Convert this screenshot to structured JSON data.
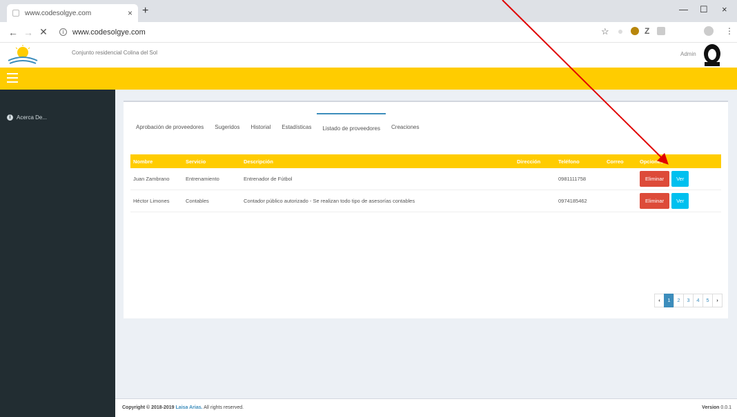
{
  "browser": {
    "tab_title": "www.codesolgye.com",
    "url": "www.codesolgye.com"
  },
  "header": {
    "app_title": "Conjunto residencial Colina del Sol",
    "user_label": "Admin"
  },
  "sidebar": {
    "items": [
      {
        "label": "Acerca De..."
      }
    ]
  },
  "tabs": [
    {
      "label": "Aprobación de proveedores"
    },
    {
      "label": "Sugeridos"
    },
    {
      "label": "Historial"
    },
    {
      "label": "Estadísticas"
    },
    {
      "label": "Listado de proveedores"
    },
    {
      "label": "Creaciones"
    }
  ],
  "active_tab": "Listado de proveedores",
  "table": {
    "headers": [
      "Nombre",
      "Servicio",
      "Descripción",
      "Dirección",
      "Teléfono",
      "Correo",
      "Opciones"
    ],
    "rows": [
      {
        "nombre": "Juan Zambrano",
        "servicio": "Entrenamiento",
        "descripcion": "Entrenador de Fútbol",
        "direccion": "",
        "telefono": "0981111758",
        "correo": ""
      },
      {
        "nombre": "Héctor Limones",
        "servicio": "Contables",
        "descripcion": "Contador público autorizado - Se realizan todo tipo de asesorías contables",
        "direccion": "",
        "telefono": "0974185462",
        "correo": ""
      }
    ],
    "delete_label": "Eliminar",
    "view_label": "Ver"
  },
  "pagination": {
    "prev": "‹",
    "pages": [
      "1",
      "2",
      "3",
      "4",
      "5"
    ],
    "next": "›",
    "current": 1
  },
  "footer": {
    "copyright_prefix": "Copyright © 2018-2019",
    "author": "Laisa Arias.",
    "rights": "All rights reserved.",
    "version_label": "Version",
    "version_number": "0.0.1"
  },
  "colors": {
    "brand_yellow": "#ffcc00",
    "sidebar_bg": "#222d32",
    "danger": "#dd4b39",
    "info": "#00c0ef",
    "annotation_arrow": "#e00000"
  }
}
